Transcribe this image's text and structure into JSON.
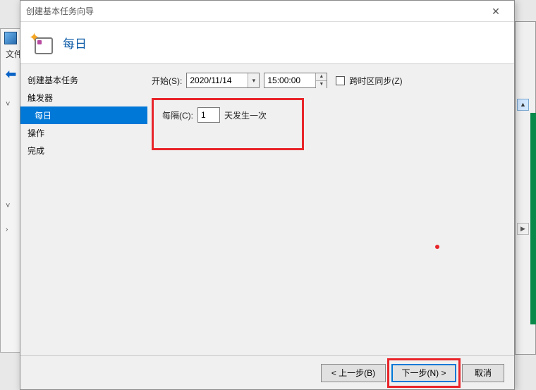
{
  "window": {
    "title": "创建基本任务向导"
  },
  "header": {
    "title": "每日"
  },
  "sidebar": {
    "items": [
      {
        "label": "创建基本任务",
        "child": false
      },
      {
        "label": "触发器",
        "child": false
      },
      {
        "label": "每日",
        "child": true,
        "selected": true
      },
      {
        "label": "操作",
        "child": false
      },
      {
        "label": "完成",
        "child": false
      }
    ]
  },
  "content": {
    "start_label": "开始(S):",
    "date_value": "2020/11/14",
    "time_value": "15:00:00",
    "sync_tz_label": "跨时区同步(Z)",
    "sync_tz_checked": false,
    "recur_label": "每隔(C):",
    "recur_value": "1",
    "recur_suffix": "天发生一次"
  },
  "footer": {
    "back": "< 上一步(B)",
    "next": "下一步(N) >",
    "cancel": "取消"
  },
  "bg": {
    "label": "文件"
  }
}
